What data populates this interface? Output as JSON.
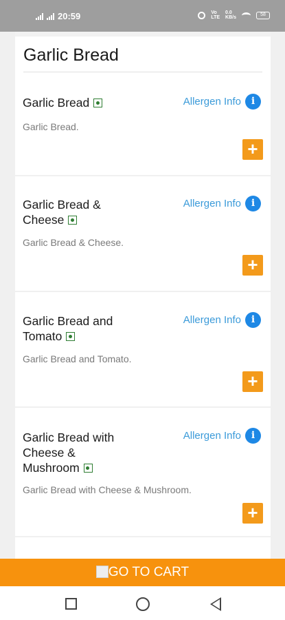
{
  "status_bar": {
    "time": "20:59",
    "battery": "58"
  },
  "category": {
    "title": "Garlic Bread"
  },
  "items": [
    {
      "name": "Garlic Bread",
      "description": "Garlic Bread.",
      "allergen_label": "Allergen Info",
      "veg": true
    },
    {
      "name": "Garlic Bread & Cheese",
      "description": "Garlic Bread & Cheese.",
      "allergen_label": "Allergen Info",
      "veg": true
    },
    {
      "name": "Garlic Bread and Tomato",
      "description": "Garlic Bread and Tomato.",
      "allergen_label": "Allergen Info",
      "veg": true
    },
    {
      "name": "Garlic Bread with Cheese & Mushroom",
      "description": "Garlic Bread with Cheese & Mushroom.",
      "allergen_label": "Allergen Info",
      "veg": true
    }
  ],
  "icons": {
    "veg": "veg-indicator-icon",
    "info": "info-icon",
    "add": "plus-icon",
    "cart": "cart-image-icon",
    "nav": [
      "recents-square-icon",
      "home-circle-icon",
      "back-triangle-icon"
    ]
  },
  "colors": {
    "accent_orange": "#f39a1b",
    "cart_bar": "#f7920d",
    "link_blue": "#3a9ad9",
    "info_blue": "#1e88e5",
    "veg_green": "#2e7d32",
    "status_bar": "#9e9e9e"
  },
  "cart": {
    "label": "GO TO CART"
  }
}
